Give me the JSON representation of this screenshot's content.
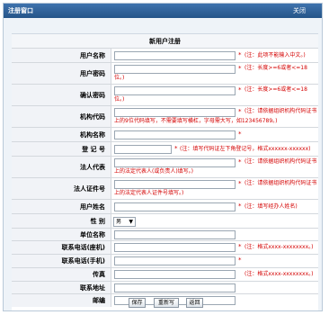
{
  "window": {
    "title": "注册窗口",
    "close_label": "关闭"
  },
  "section_title": "新用户注册",
  "required_mark": "*",
  "fields": {
    "username": {
      "label": "用户名称",
      "note": "(注：此项不能输入中文。)"
    },
    "password": {
      "label": "用户密码",
      "note_1": "(注：长度>=6或者<=18",
      "note_2": "位。)"
    },
    "confirm_password": {
      "label": "确认密码",
      "note_1": "(注：长度>=6或者<=18",
      "note_2": "位。)"
    },
    "org_code": {
      "label": "机构代码",
      "note_1": "(注：请依据组织机构代码证书",
      "note_2": "上的9位代码填写，不需要填写横杠，字母需大写，如123456789。)"
    },
    "org_name": {
      "label": "机构名称"
    },
    "reg_no": {
      "label": "登  记  号",
      "note": "(注：填写代码证左下角登记号，格式xxxxxx-xxxxxx)"
    },
    "legal_rep": {
      "label": "法人代表",
      "note_1": "(注：请依据组织机构代码证书",
      "note_2": "上的法定代表人(或负责人)填写。)"
    },
    "legal_id": {
      "label": "法人证件号",
      "note_1": "(注：请依据组织机构代码证书",
      "note_2": "上的法定代表人证件号填写。)"
    },
    "user_real_name": {
      "label": "用户姓名",
      "note": "(注：填写经办人姓名)"
    },
    "gender": {
      "label": "性  别",
      "value": "男"
    },
    "unit_name": {
      "label": "单位名称"
    },
    "phone": {
      "label": "联系电话(座机)",
      "note": "(注：格式xxxx-xxxxxxxx。)"
    },
    "mobile": {
      "label": "联系电话(手机)"
    },
    "fax": {
      "label": "传真",
      "note": "(注：格式xxxx-xxxxxxxx。)"
    },
    "address": {
      "label": "联系地址"
    },
    "postcode": {
      "label": "邮编"
    }
  },
  "buttons": {
    "save": "保存",
    "reset": "重新写",
    "back": "返回"
  }
}
